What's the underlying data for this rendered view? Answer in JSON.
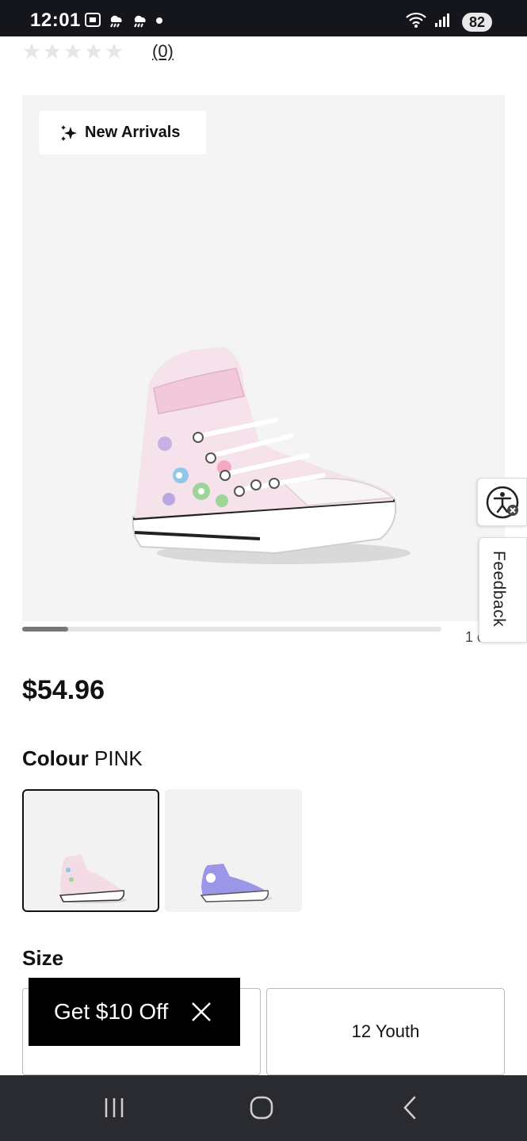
{
  "status_bar": {
    "time": "12:01",
    "battery": "82",
    "icons_left": [
      "screenshot-icon",
      "weather-icon",
      "weather-icon",
      "dot-icon"
    ],
    "icons_right": [
      "wifi-icon",
      "signal-icon"
    ]
  },
  "rating": {
    "stars_filled": 0,
    "stars_total": 5,
    "count": "(0)"
  },
  "hero": {
    "badge_label": "New Arrivals",
    "badge_icon": "sparkle-icon",
    "pager": "1 o",
    "scroll_fraction": 0.11
  },
  "side_tabs": {
    "accessibility_icon": "accessibility-icon",
    "feedback_label": "Feedback"
  },
  "product": {
    "price": "$54.96",
    "colour_label": "Colour",
    "colour_value": "PINK",
    "swatches": [
      {
        "name": "pink",
        "selected": true,
        "color": "#f6dce6"
      },
      {
        "name": "purple",
        "selected": false,
        "color": "#9b96e8"
      }
    ],
    "size_heading": "Size",
    "sizes": [
      "",
      "12 Youth"
    ]
  },
  "promo": {
    "label": "Get $10 Off",
    "close_icon": "close-icon"
  },
  "nav": {
    "recents_icon": "recents-icon",
    "home_icon": "home-icon",
    "back_icon": "back-icon"
  },
  "colors": {
    "status_bar_bg": "#14161b",
    "nav_bg": "#2a2b30",
    "hero_bg": "#f4f4f4",
    "promo_bg": "#000000"
  }
}
